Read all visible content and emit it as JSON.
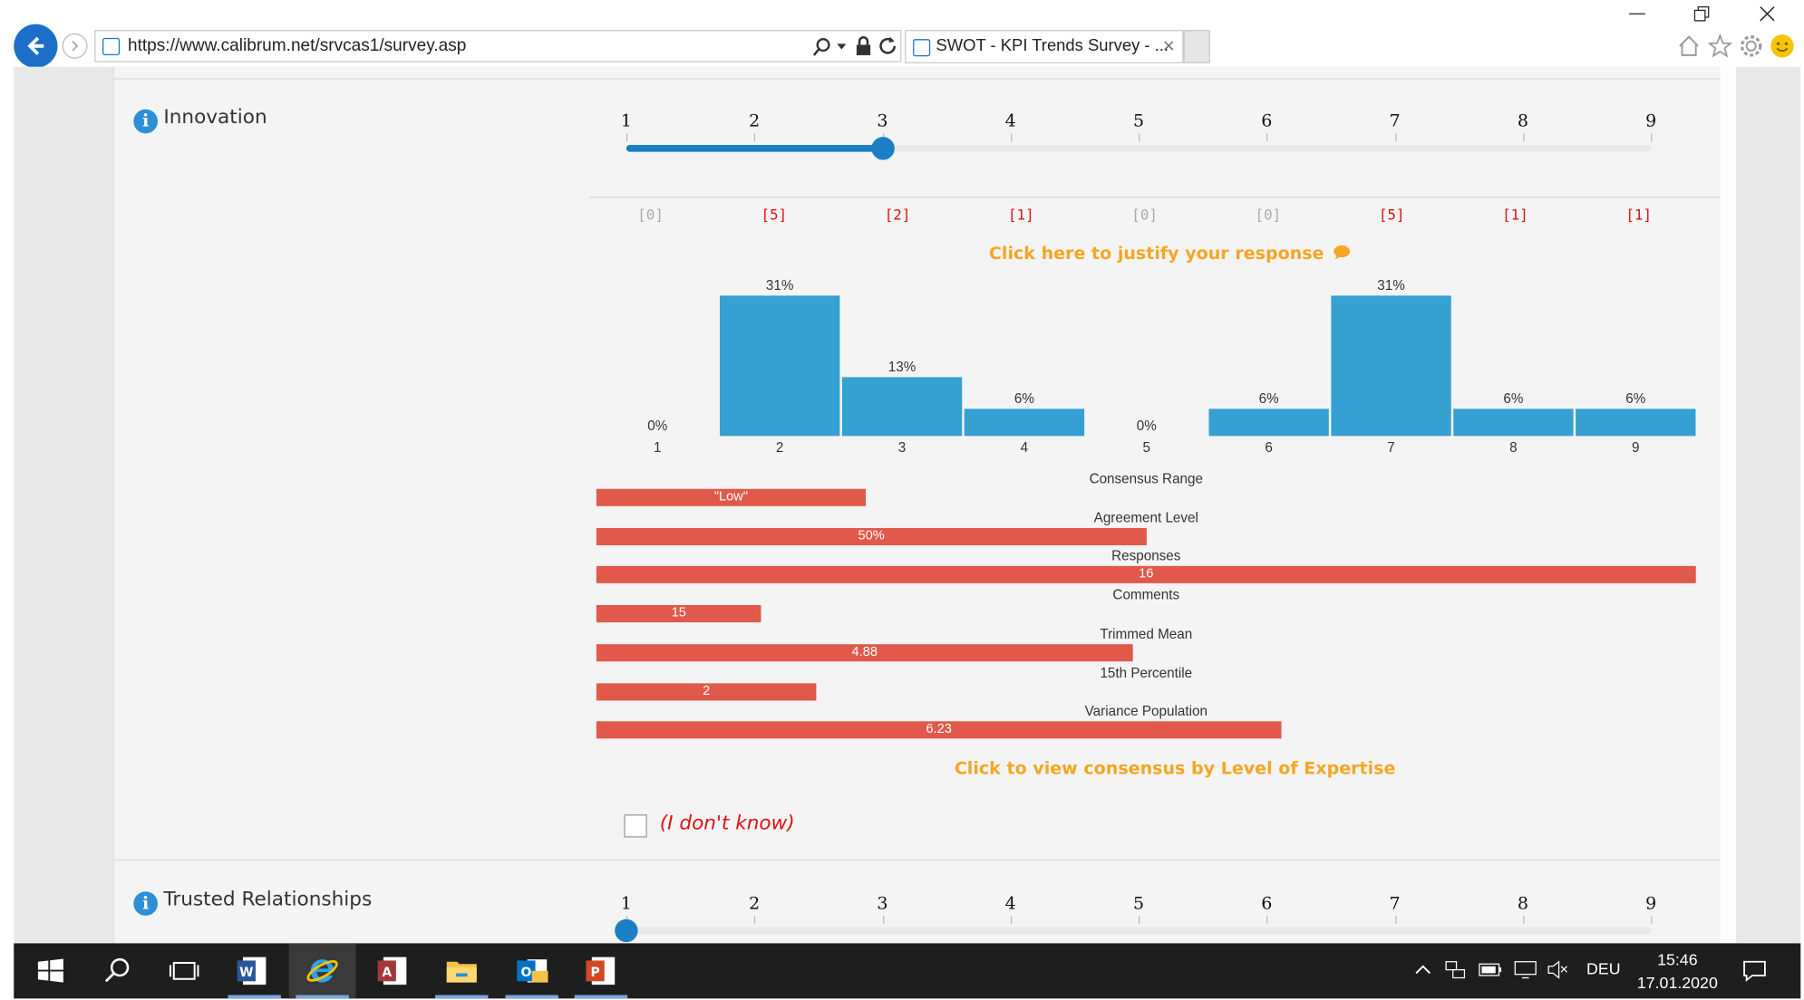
{
  "browser": {
    "url": "https://www.calibrum.net/srvcas1/survey.asp",
    "tab_title": "SWOT - KPI Trends Survey - ...",
    "tab_close": "×"
  },
  "questions": [
    {
      "label": "Innovation",
      "scale": [
        "1",
        "2",
        "3",
        "4",
        "5",
        "6",
        "7",
        "8",
        "9"
      ],
      "selected": 3,
      "counts": [
        "[0]",
        "[5]",
        "[2]",
        "[1]",
        "[0]",
        "[0]",
        "[5]",
        "[1]",
        "[1]"
      ],
      "counts_zero": [
        true,
        false,
        false,
        false,
        true,
        true,
        false,
        false,
        false
      ],
      "justify_link": "Click here to justify your response",
      "expertise_link": "Click to view consensus by Level of Expertise",
      "dont_know": "(I don't know)"
    },
    {
      "label": "Trusted Relationships",
      "scale": [
        "1",
        "2",
        "3",
        "4",
        "5",
        "6",
        "7",
        "8",
        "9"
      ],
      "selected": 1
    }
  ],
  "chart_data": [
    {
      "type": "bar",
      "categories": [
        "1",
        "2",
        "3",
        "4",
        "5",
        "6",
        "7",
        "8",
        "9"
      ],
      "values": [
        0,
        31,
        13,
        6,
        0,
        6,
        31,
        6,
        6
      ],
      "value_labels": [
        "0%",
        "31%",
        "13%",
        "6%",
        "0%",
        "6%",
        "31%",
        "6%",
        "6%"
      ],
      "ylim": [
        0,
        31
      ],
      "color": "#35a0d2"
    },
    {
      "type": "bar",
      "orientation": "horizontal",
      "stats": [
        {
          "label": "Consensus Range",
          "value_text": "\"Low\"",
          "fraction": 0.245
        },
        {
          "label": "Agreement Level",
          "value_text": "50%",
          "fraction": 0.5
        },
        {
          "label": "Responses",
          "value_text": "16",
          "fraction": 1.0
        },
        {
          "label": "Comments",
          "value_text": "15",
          "fraction": 0.15
        },
        {
          "label": "Trimmed Mean",
          "value_text": "4.88",
          "fraction": 0.488
        },
        {
          "label": "15th Percentile",
          "value_text": "2",
          "fraction": 0.2
        },
        {
          "label": "Variance Population",
          "value_text": "6.23",
          "fraction": 0.623
        }
      ],
      "color": "#e0594a"
    }
  ],
  "taskbar": {
    "language": "DEU",
    "time": "15:46",
    "date": "17.01.2020"
  },
  "colors": {
    "accent": "#1a7fc4",
    "link": "#f5a623",
    "count_red": "#e01010",
    "count_zero": "#aaaaaa"
  }
}
